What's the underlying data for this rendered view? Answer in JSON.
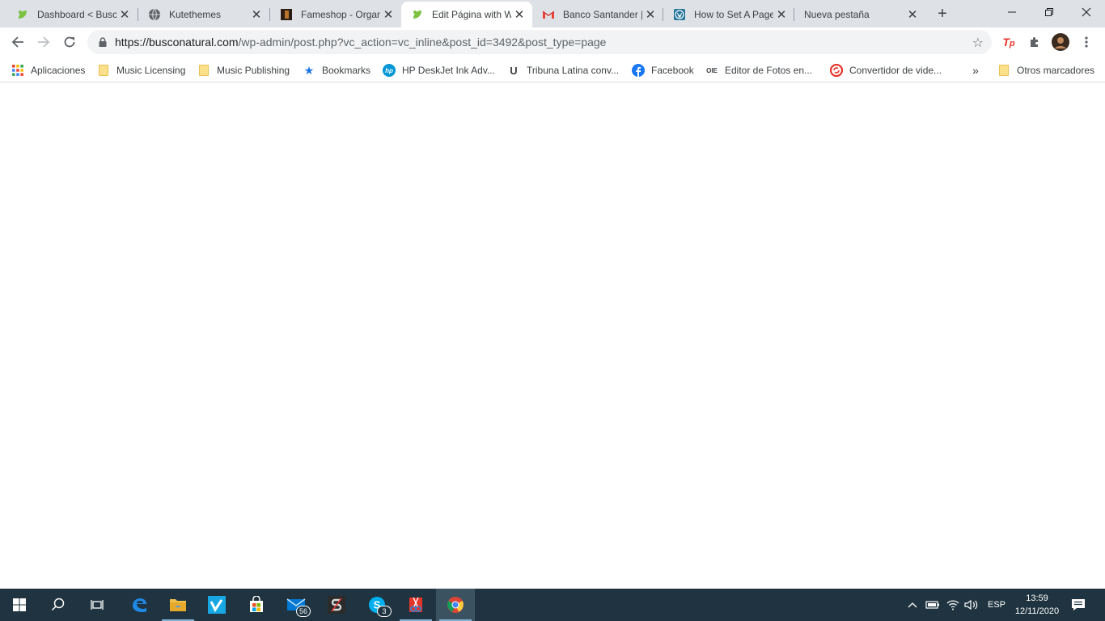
{
  "tabs": [
    {
      "title": "Dashboard < Busc",
      "favicon": "leaf-icon",
      "active": false
    },
    {
      "title": "Kutethemes",
      "favicon": "globe-icon",
      "active": false
    },
    {
      "title": "Fameshop - Organ",
      "favicon": "fameshop-icon",
      "active": false
    },
    {
      "title": "Edit Página with W",
      "favicon": "leaf-icon",
      "active": true
    },
    {
      "title": "Banco Santander |",
      "favicon": "gmail-icon",
      "active": false
    },
    {
      "title": "How to Set A Page",
      "favicon": "wordpress-icon",
      "active": false
    },
    {
      "title": "Nueva pestaña",
      "favicon": "none",
      "active": false
    }
  ],
  "address": {
    "host": "https://busconatural.com",
    "path": "/wp-admin/post.php?vc_action=vc_inline&post_id=3492&post_type=page"
  },
  "bookmarks": {
    "apps": "Aplicaciones",
    "items": [
      "Music Licensing",
      "Music Publishing",
      "Bookmarks",
      "HP DeskJet Ink Adv...",
      "Tribuna Latina conv...",
      "Facebook",
      "Editor de Fotos en...",
      "Convertidor de vide..."
    ],
    "overflow": "»",
    "other": "Otros marcadores"
  },
  "taskbar": {
    "mail_badge": "56",
    "skype_badge": "3",
    "language": "ESP",
    "time": "13:59",
    "date": "12/11/2020"
  },
  "colors": {
    "tabstrip": "#dee1e6",
    "taskbar": "#1f3440",
    "accent": "#1a73e8"
  }
}
